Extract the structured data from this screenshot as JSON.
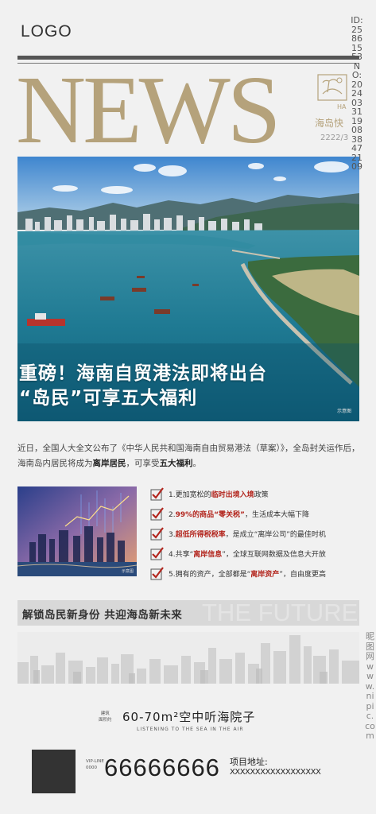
{
  "header": {
    "logo": "LOGO",
    "masthead": "NEWS",
    "side_tag": "HA",
    "side_title": "海岛快",
    "side_date": "2222/3"
  },
  "hero": {
    "headline_line1": "重磅！海南自贸港法即将出台",
    "headline_line2": "“岛民”可享五大福利",
    "sample_mark": "示意图"
  },
  "intro": {
    "part1": "近日，全国人大全文公布了《中华人民共和国海南自由贸易港法（草案）》，全岛封关运作后，海南岛内居民将成为",
    "bold1": "离岸居民",
    "part2": "，可享受",
    "bold2": "五大福利",
    "part3": "。"
  },
  "photo": {
    "mark": "示意图"
  },
  "benefits": [
    {
      "pre": "1.更加宽松的",
      "hl": "临时出境入境",
      "post": "政策"
    },
    {
      "pre": "2.",
      "hl": "99%的商品“零关税”",
      "post": "，生活成本大幅下降"
    },
    {
      "pre": "3.",
      "hl": "超低所得税税率",
      "post": "，是成立“离岸公司”的最佳时机"
    },
    {
      "pre": "4.共享“",
      "hl": "离岸信息",
      "post": "”，全球互联网数据及信息大开放"
    },
    {
      "pre": "5.拥有的资产，全部都是“",
      "hl": "离岸资产",
      "post": "”，自由度更高"
    }
  ],
  "band": {
    "title": "解锁岛民新身份  共迎海岛新未来",
    "ghost": "THE FUTURE"
  },
  "area": {
    "label_line1": "建筑",
    "label_line2": "面积约",
    "title": "60-70m²空中听海院子",
    "subtitle": "LISTENING TO THE SEA IN THE AIR"
  },
  "contact": {
    "vip_line1": "VIP-LINE",
    "vip_line2": "0000",
    "phone": "66666666",
    "address_label": "项目地址:",
    "address_value": "XXXXXXXXXXXXXXXXXX"
  },
  "watermark": {
    "id_text": "ID:25861553NO:20240331190838472109",
    "site_text": "昵图网www.nipic.com"
  },
  "colors": {
    "gold": "#b5a27b",
    "accent_red": "#b3261e",
    "band_gray": "#d8d8d8"
  }
}
